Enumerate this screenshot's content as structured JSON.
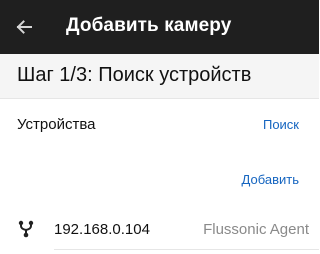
{
  "toolbar": {
    "back_icon": "arrow-left-icon",
    "title": "Добавить камеру",
    "background": "#1f1f1f"
  },
  "step": {
    "title": "Шаг 1/3: Поиск устройств"
  },
  "devices_section": {
    "label": "Устройства",
    "search_label": "Поиск",
    "add_label": "Добавить",
    "link_color": "#1565c0"
  },
  "devices": [
    {
      "icon": "network-fork-icon",
      "ip": "192.168.0.104",
      "type": "Flussonic Agent"
    }
  ]
}
